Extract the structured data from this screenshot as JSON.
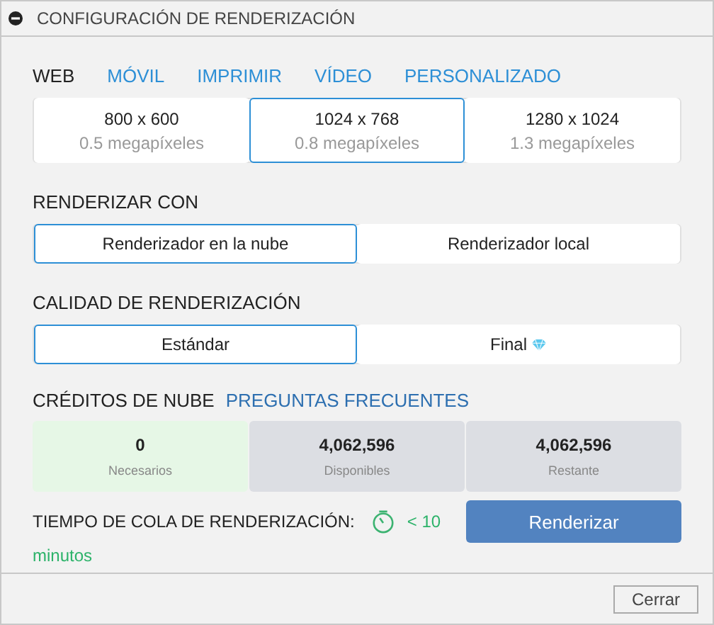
{
  "panel": {
    "title": "CONFIGURACIÓN DE RENDERIZACIÓN",
    "expanded": true
  },
  "tabs": [
    {
      "label": "WEB",
      "selected": true
    },
    {
      "label": "MÓVIL",
      "selected": false
    },
    {
      "label": "IMPRIMIR",
      "selected": false
    },
    {
      "label": "VÍDEO",
      "selected": false
    },
    {
      "label": "PERSONALIZADO",
      "selected": false
    }
  ],
  "resolutions": [
    {
      "size": "800 x 600",
      "megapixels": "0.5 megapíxeles",
      "selected": false
    },
    {
      "size": "1024 x 768",
      "megapixels": "0.8 megapíxeles",
      "selected": true
    },
    {
      "size": "1280 x 1024",
      "megapixels": "1.3 megapíxeles",
      "selected": false
    }
  ],
  "render_with": {
    "heading": "RENDERIZAR CON",
    "options": [
      {
        "label": "Renderizador en la nube",
        "selected": true
      },
      {
        "label": "Renderizador local",
        "selected": false
      }
    ]
  },
  "quality": {
    "heading": "CALIDAD DE RENDERIZACIÓN",
    "options": [
      {
        "label": "Estándar",
        "selected": true,
        "premium": false
      },
      {
        "label": "Final",
        "selected": false,
        "premium": true
      }
    ]
  },
  "credits": {
    "heading": "CRÉDITOS DE NUBE",
    "faq_link": "PREGUNTAS FRECUENTES",
    "cells": [
      {
        "value": "0",
        "label": "Necesarios",
        "color": "#e6f7e6"
      },
      {
        "value": "4,062,596",
        "label": "Disponibles",
        "color": "#dcdee3"
      },
      {
        "value": "4,062,596",
        "label": "Restante",
        "color": "#dcdee3"
      }
    ]
  },
  "queue": {
    "label": "TIEMPO DE COLA DE RENDERIZACIÓN:",
    "value": "< 10",
    "unit": "minutos"
  },
  "render_button": "Renderizar",
  "close_button": "Cerrar"
}
